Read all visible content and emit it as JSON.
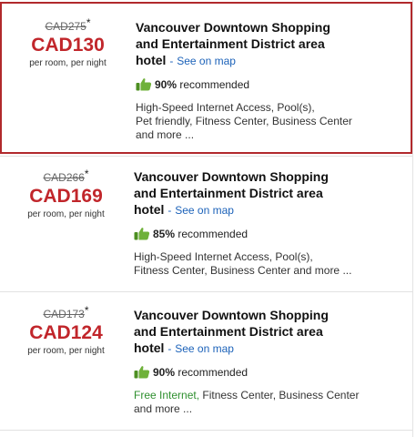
{
  "hotels": [
    {
      "old_price": "CAD275",
      "asterisk": "*",
      "price": "CAD130",
      "per_night": "per room, per night",
      "name_line1": "Vancouver Downtown Shopping",
      "name_line2": "and Entertainment District area",
      "name_line3": "hotel",
      "separator": "-",
      "map_link": "See on map",
      "recommended_pct": "90%",
      "recommended_label": "recommended",
      "amenities_line1": "High-Speed Internet Access,  Pool(s),",
      "amenities_line2": "Pet friendly,  Fitness Center,  Business Center",
      "amenities_line3": "and more ..."
    },
    {
      "old_price": "CAD266",
      "asterisk": "*",
      "price": "CAD169",
      "per_night": "per room, per night",
      "name_line1": "Vancouver Downtown Shopping",
      "name_line2": "and Entertainment District area",
      "name_line3": "hotel",
      "separator": "-",
      "map_link": "See on map",
      "recommended_pct": "85%",
      "recommended_label": "recommended",
      "amenities_line1": "High-Speed Internet Access,  Pool(s),",
      "amenities_line2": "Fitness Center,  Business Center  and more ..."
    },
    {
      "old_price": "CAD173",
      "asterisk": "*",
      "price": "CAD124",
      "per_night": "per room, per night",
      "name_line1": "Vancouver Downtown Shopping",
      "name_line2": "and Entertainment District area",
      "name_line3": "hotel",
      "separator": "-",
      "map_link": "See on map",
      "recommended_pct": "90%",
      "recommended_label": "recommended",
      "amenities_free": "Free Internet,",
      "amenities_line1_rest": " Fitness Center,  Business Center",
      "amenities_line2": "and more ..."
    }
  ],
  "colors": {
    "price_red": "#c1262b",
    "link_blue": "#1c62b9",
    "free_green": "#2e8f2e",
    "selected_border": "#b1292c",
    "thumb_green": "#5aa02c"
  },
  "icons": {
    "recommend": "thumbs-up-icon"
  }
}
